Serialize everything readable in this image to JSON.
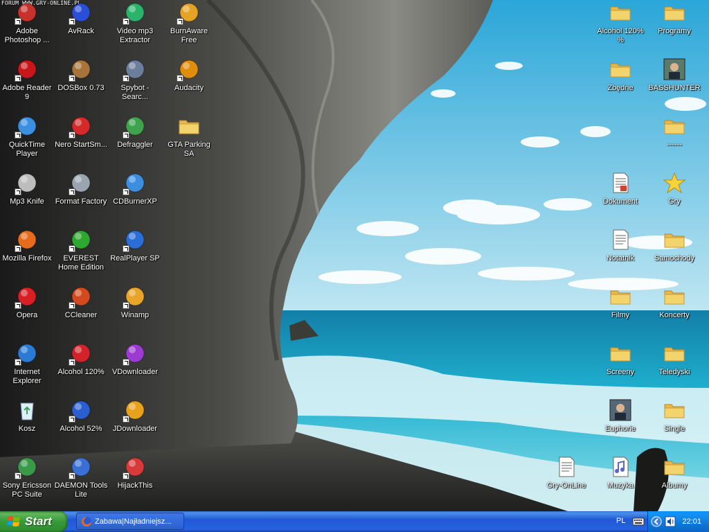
{
  "watermark": "FORUM WWW.GRY-ONLINE.PL",
  "icons_left": [
    {
      "label": "Adobe Photoshop ...",
      "icon": "photoshop-icon",
      "color": "#c8312c"
    },
    {
      "label": "AvRack",
      "icon": "avrack-icon",
      "color": "#2a4fd6"
    },
    {
      "label": "Video mp3 Extractor",
      "icon": "video-mp3-icon",
      "color": "#2bb36b"
    },
    {
      "label": "BurnAware Free",
      "icon": "burnaware-icon",
      "color": "#e5a323"
    },
    {
      "label": "Adobe Reader 9",
      "icon": "adobe-reader-icon",
      "color": "#c8171b"
    },
    {
      "label": "DOSBox 0.73",
      "icon": "dosbox-icon",
      "color": "#a8743a"
    },
    {
      "label": "Spybot - Searc...",
      "icon": "spybot-icon",
      "color": "#6b7e9c"
    },
    {
      "label": "Audacity",
      "icon": "audacity-icon",
      "color": "#e08d0c"
    },
    {
      "label": "QuickTime Player",
      "icon": "quicktime-icon",
      "color": "#3a8fe0"
    },
    {
      "label": "Nero StartSm...",
      "icon": "nero-icon",
      "color": "#d42a2a"
    },
    {
      "label": "Defraggler",
      "icon": "defraggler-icon",
      "color": "#3fa34d"
    },
    {
      "label": "GTA Parking SA",
      "icon": "folder-icon",
      "color": "#f3d36b"
    },
    {
      "label": "Mp3 Knife",
      "icon": "mp3-knife-icon",
      "color": "#bdbdbd"
    },
    {
      "label": "Format Factory",
      "icon": "format-factory-icon",
      "color": "#9aa5b1"
    },
    {
      "label": "CDBurnerXP",
      "icon": "cdburnerxp-icon",
      "color": "#3e8ee0"
    },
    {
      "label": "Mozilla Firefox",
      "icon": "firefox-icon",
      "color": "#e66b1a"
    },
    {
      "label": "EVEREST Home Edition",
      "icon": "everest-icon",
      "color": "#2ea82e"
    },
    {
      "label": "RealPlayer SP",
      "icon": "realplayer-icon",
      "color": "#2b6fd6"
    },
    {
      "label": "Opera",
      "icon": "opera-icon",
      "color": "#d81f26"
    },
    {
      "label": "CCleaner",
      "icon": "ccleaner-icon",
      "color": "#d44a1e"
    },
    {
      "label": "Winamp",
      "icon": "winamp-icon",
      "color": "#e8a52a"
    },
    {
      "label": "Internet Explorer",
      "icon": "internet-explorer-icon",
      "color": "#2a7ad6"
    },
    {
      "label": "Alcohol 120%",
      "icon": "alcohol-120-icon",
      "color": "#d2232a"
    },
    {
      "label": "VDownloader",
      "icon": "vdownloader-icon",
      "color": "#9b3bd2"
    },
    {
      "label": "Kosz",
      "icon": "recycle-bin-icon",
      "color": "#6fb8e0"
    },
    {
      "label": "Alcohol 52%",
      "icon": "alcohol-52-icon",
      "color": "#2b5fd1"
    },
    {
      "label": "JDownloader",
      "icon": "jdownloader-icon",
      "color": "#e6a21a"
    },
    {
      "label": "Sony Ericsson PC Suite",
      "icon": "sony-ericsson-icon",
      "color": "#3a9a4a"
    },
    {
      "label": "DAEMON Tools Lite",
      "icon": "daemon-tools-icon",
      "color": "#3a6fd6"
    },
    {
      "label": "HijackThis",
      "icon": "hijackthis-icon",
      "color": "#d83a3a"
    }
  ],
  "icons_right": [
    {
      "label": "Alcohol 120% %",
      "icon": "folder-icon",
      "color": "#f3d36b"
    },
    {
      "label": "Programy",
      "icon": "folder-icon",
      "color": "#f3d36b"
    },
    {
      "label": "Zbędne",
      "icon": "folder-icon",
      "color": "#f3d36b"
    },
    {
      "label": "BASSHUNTER",
      "icon": "basshunter-folder-icon",
      "color": "#5c7a6a"
    },
    {
      "label": "------",
      "icon": "folder-icon",
      "color": "#f3d36b"
    },
    {
      "label": "Dokument",
      "icon": "document-icon",
      "color": "#ffffff"
    },
    {
      "label": "Gry",
      "icon": "star-icon",
      "color": "#f6d23b"
    },
    {
      "label": "Notatnik",
      "icon": "notepad-icon",
      "color": "#ffffff"
    },
    {
      "label": "Samochody",
      "icon": "folder-icon",
      "color": "#f3d36b"
    },
    {
      "label": "Filmy",
      "icon": "folder-icon",
      "color": "#f3d36b"
    },
    {
      "label": "Koncerty",
      "icon": "folder-icon",
      "color": "#f3d36b"
    },
    {
      "label": "Screeny",
      "icon": "folder-icon",
      "color": "#f3d36b"
    },
    {
      "label": "Teledyski",
      "icon": "folder-icon",
      "color": "#f3d36b"
    },
    {
      "label": "Euphorie",
      "icon": "euphorie-image-icon",
      "color": "#556677"
    },
    {
      "label": "Single",
      "icon": "folder-icon",
      "color": "#f3d36b"
    },
    {
      "label": "Gry-OnLine",
      "icon": "text-file-icon",
      "color": "#ffffff"
    },
    {
      "label": "Muzyka",
      "icon": "music-file-icon",
      "color": "#5a66cc"
    },
    {
      "label": "Albumy",
      "icon": "folder-icon",
      "color": "#f3d36b"
    }
  ],
  "taskbar": {
    "start_label": "Start",
    "task_label": "Zabawa|Najładniejsz...",
    "language": "PL",
    "clock": "22:01"
  }
}
